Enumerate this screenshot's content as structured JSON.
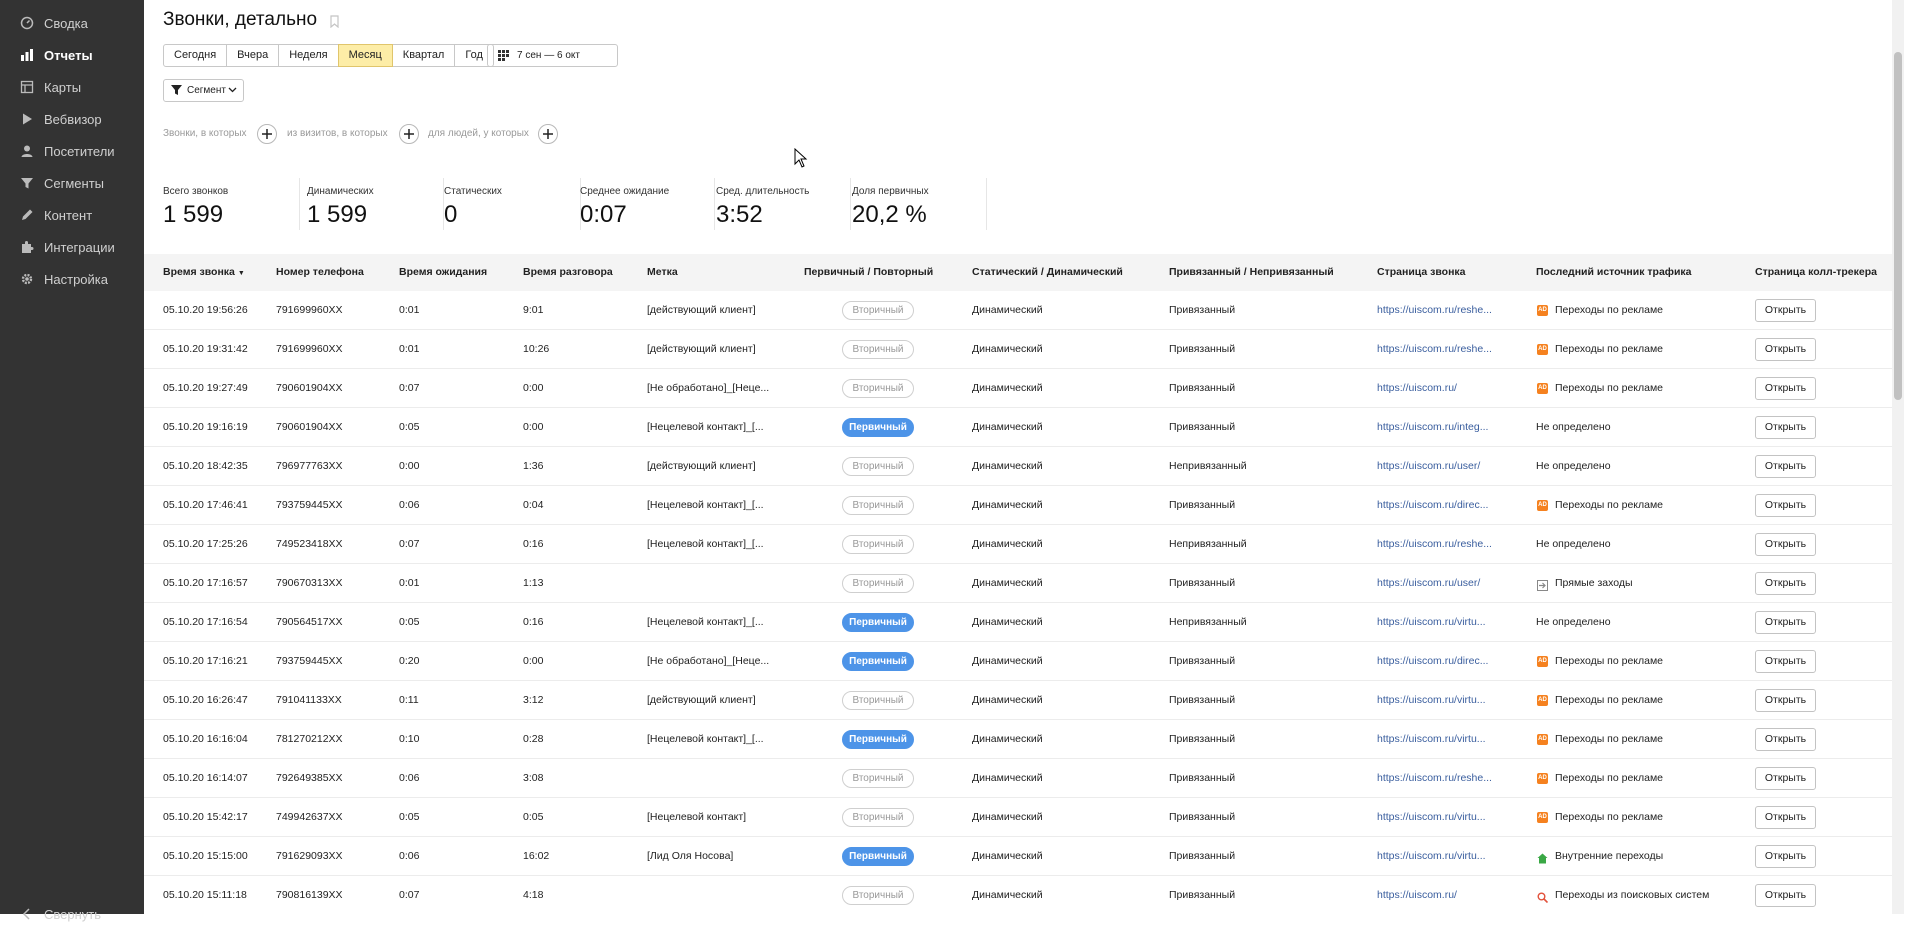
{
  "sidebar": {
    "items": [
      {
        "label": "Сводка",
        "icon": "dashboard-icon"
      },
      {
        "label": "Отчеты",
        "icon": "bar-chart-icon",
        "active": true
      },
      {
        "label": "Карты",
        "icon": "map-icon"
      },
      {
        "label": "Вебвизор",
        "icon": "play-icon"
      },
      {
        "label": "Посетители",
        "icon": "person-icon"
      },
      {
        "label": "Сегменты",
        "icon": "filter-icon"
      },
      {
        "label": "Контент",
        "icon": "pencil-icon"
      },
      {
        "label": "Интеграции",
        "icon": "puzzle-icon"
      },
      {
        "label": "Настройка",
        "icon": "gear-icon"
      }
    ],
    "collapse_label": "Свернуть"
  },
  "header": {
    "title": "Звонки, детально"
  },
  "period": {
    "buttons": [
      "Сегодня",
      "Вчера",
      "Неделя",
      "Месяц",
      "Квартал",
      "Год"
    ],
    "active": "Месяц",
    "date_range": "7 сен — 6 окт"
  },
  "segment": {
    "label": "Сегмент"
  },
  "filters": {
    "calls_label": "Звонки, в которых",
    "visits_label": "из визитов, в которых",
    "people_label": "для людей, у которых"
  },
  "metrics": [
    {
      "label": "Всего звонков",
      "value": "1 599"
    },
    {
      "label": "Динамических",
      "value": "1 599"
    },
    {
      "label": "Статических",
      "value": "0"
    },
    {
      "label": "Среднее ожидание",
      "value": "0:07"
    },
    {
      "label": "Сред. длительность",
      "value": "3:52"
    },
    {
      "label": "Доля первичных",
      "value": "20,2 %"
    }
  ],
  "table": {
    "columns": [
      "Время звонка",
      "Номер телефона",
      "Время ожидания",
      "Время разговора",
      "Метка",
      "Первичный / Повторный",
      "Статический / Динамический",
      "Привязанный / Непривязанный",
      "Страница звонка",
      "Последний источник трафика",
      "Страница колл-трекера"
    ],
    "sort_indicator": "▼",
    "open_label": "Открыть",
    "rows": [
      [
        "05.10.20 19:56:26",
        "791699960XX",
        "0:01",
        "9:01",
        "[действующий клиент]",
        "Вторичный",
        "Динамический",
        "Привязанный",
        "https://uiscom.ru/reshe...",
        "Переходы по рекламе",
        "ad"
      ],
      [
        "05.10.20 19:31:42",
        "791699960XX",
        "0:01",
        "10:26",
        "[действующий клиент]",
        "Вторичный",
        "Динамический",
        "Привязанный",
        "https://uiscom.ru/reshe...",
        "Переходы по рекламе",
        "ad"
      ],
      [
        "05.10.20 19:27:49",
        "790601904XX",
        "0:07",
        "0:00",
        "[Не обработано]_[Неце...",
        "Вторичный",
        "Динамический",
        "Привязанный",
        "https://uiscom.ru/",
        "Переходы по рекламе",
        "ad"
      ],
      [
        "05.10.20 19:16:19",
        "790601904XX",
        "0:05",
        "0:00",
        "[Нецелевой контакт]_[...",
        "Первичный",
        "Динамический",
        "Привязанный",
        "https://uiscom.ru/integ...",
        "Не определено",
        ""
      ],
      [
        "05.10.20 18:42:35",
        "796977763XX",
        "0:00",
        "1:36",
        "[действующий клиент]",
        "Вторичный",
        "Динамический",
        "Непривязанный",
        "https://uiscom.ru/user/",
        "Не определено",
        ""
      ],
      [
        "05.10.20 17:46:41",
        "793759445XX",
        "0:06",
        "0:04",
        "[Нецелевой контакт]_[...",
        "Вторичный",
        "Динамический",
        "Привязанный",
        "https://uiscom.ru/direc...",
        "Переходы по рекламе",
        "ad"
      ],
      [
        "05.10.20 17:25:26",
        "749523418XX",
        "0:07",
        "0:16",
        "[Нецелевой контакт]_[...",
        "Вторичный",
        "Динамический",
        "Непривязанный",
        "https://uiscom.ru/reshe...",
        "Не определено",
        ""
      ],
      [
        "05.10.20 17:16:57",
        "790670313XX",
        "0:01",
        "1:13",
        "",
        "Вторичный",
        "Динамический",
        "Привязанный",
        "https://uiscom.ru/user/",
        "Прямые заходы",
        "direct"
      ],
      [
        "05.10.20 17:16:54",
        "790564517XX",
        "0:05",
        "0:16",
        "[Нецелевой контакт]_[...",
        "Первичный",
        "Динамический",
        "Непривязанный",
        "https://uiscom.ru/virtu...",
        "Не определено",
        ""
      ],
      [
        "05.10.20 17:16:21",
        "793759445XX",
        "0:20",
        "0:00",
        "[Не обработано]_[Неце...",
        "Первичный",
        "Динамический",
        "Привязанный",
        "https://uiscom.ru/direc...",
        "Переходы по рекламе",
        "ad"
      ],
      [
        "05.10.20 16:26:47",
        "791041133XX",
        "0:11",
        "3:12",
        "[действующий клиент]",
        "Вторичный",
        "Динамический",
        "Привязанный",
        "https://uiscom.ru/virtu...",
        "Переходы по рекламе",
        "ad"
      ],
      [
        "05.10.20 16:16:04",
        "781270212XX",
        "0:10",
        "0:28",
        "[Нецелевой контакт]_[...",
        "Первичный",
        "Динамический",
        "Привязанный",
        "https://uiscom.ru/virtu...",
        "Переходы по рекламе",
        "ad"
      ],
      [
        "05.10.20 16:14:07",
        "792649385XX",
        "0:06",
        "3:08",
        "",
        "Вторичный",
        "Динамический",
        "Привязанный",
        "https://uiscom.ru/reshe...",
        "Переходы по рекламе",
        "ad"
      ],
      [
        "05.10.20 15:42:17",
        "749942637XX",
        "0:05",
        "0:05",
        "[Нецелевой контакт]",
        "Вторичный",
        "Динамический",
        "Привязанный",
        "https://uiscom.ru/virtu...",
        "Переходы по рекламе",
        "ad"
      ],
      [
        "05.10.20 15:15:00",
        "791629093XX",
        "0:06",
        "16:02",
        "[Лид Оля Носова]",
        "Первичный",
        "Динамический",
        "Привязанный",
        "https://uiscom.ru/virtu...",
        "Внутренние переходы",
        "internal"
      ],
      [
        "05.10.20 15:11:18",
        "790816139XX",
        "0:07",
        "4:18",
        "",
        "Вторичный",
        "Динамический",
        "Привязанный",
        "https://uiscom.ru/",
        "Переходы из поисковых систем",
        "search"
      ]
    ]
  },
  "colors": {
    "sidebar_bg": "#333333",
    "active_period": "#fdeda7",
    "primary_badge": "#4d94e8",
    "ad_icon": "#f5811f",
    "link": "#3a5e9e"
  }
}
